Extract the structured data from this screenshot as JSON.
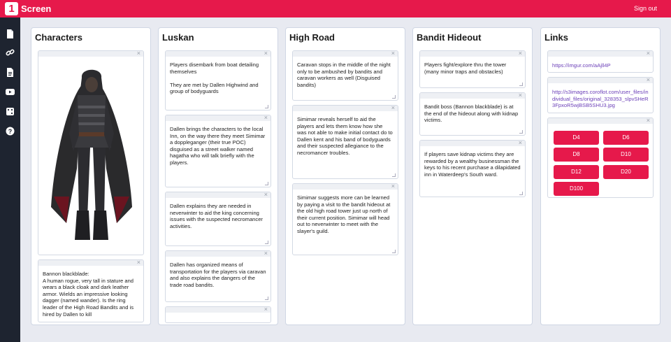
{
  "app": {
    "logo_char": "1",
    "brand": "Screen",
    "sign_out": "Sign out"
  },
  "sidebar": {
    "icons": [
      "document-icon",
      "link-icon",
      "file-text-icon",
      "youtube-icon",
      "dice-icon",
      "help-icon"
    ]
  },
  "columns": {
    "characters": {
      "title": "Characters",
      "bannon": "Bannon blackblade:\nA human rogue, very tall in stature and wears a black cloak and dark leather armor. Wields an impressive looking dagger (named wander). Is the ring leader of the High Road Bandits and is hired by Dallen to kill"
    },
    "luskan": {
      "title": "Luskan",
      "cards": [
        "Players disembark from boat detailing themselves\n\nThey are met by Dallen Highwind and group of bodyguards",
        "Dallen brings the characters to the local Inn, on the way there they meet Simimar a doppleganger  (their true POC) disguised as a street walker named hagatha who will talk briefly with the players.",
        "Dallen explains they are needed in neverwinter to aid the king concerning issues with the suspected necromancer activities.",
        "Dallen has organized means of transportation for the players via caravan and also explains the dangers of the trade road bandits."
      ]
    },
    "high_road": {
      "title": "High Road",
      "cards": [
        "Caravan stops in the middle of the night only to be ambushed by bandits and caravan workers as well (Disguised bandits)",
        "Simimar reveals herself to aid the players and lets them know how she was not able to make initial contact do to Dallen kent and his band of bodyguards and their suspected allegiance to the necromancer troubles.",
        "Simimar suggests more can be learned by paying a visit to the bandit hideout at the old high road tower just up north of their current position. Simimar will head out to neverwinter to meet with the slayer's guild."
      ]
    },
    "bandit_hideout": {
      "title": "Bandit Hideout",
      "cards": [
        "Players fight/explore thru the tower (many minor traps and obstacles)",
        "Bandit boss (Bannon blackblade) is at the end of the hideout along with kidnap victims.",
        "If players save kidnap victims they are rewarded by a wealthy businessman the keys to his recent purchase a dilapidated inn in Waterdeep's South ward."
      ]
    },
    "links": {
      "title": "Links",
      "link1": "https://imgur.com/aAjll4P",
      "link2": "http://s3images.coroflot.com/user_files/individual_files/original_328353_slpvSHeR3FpxoR5wjBSB5SHU3.jpg",
      "dice": [
        "D4",
        "D6",
        "D8",
        "D10",
        "D12",
        "D20",
        "D100"
      ]
    }
  },
  "colors": {
    "accent": "#e6194b",
    "sidebar": "#1e2430",
    "link": "#6b3fb8"
  }
}
